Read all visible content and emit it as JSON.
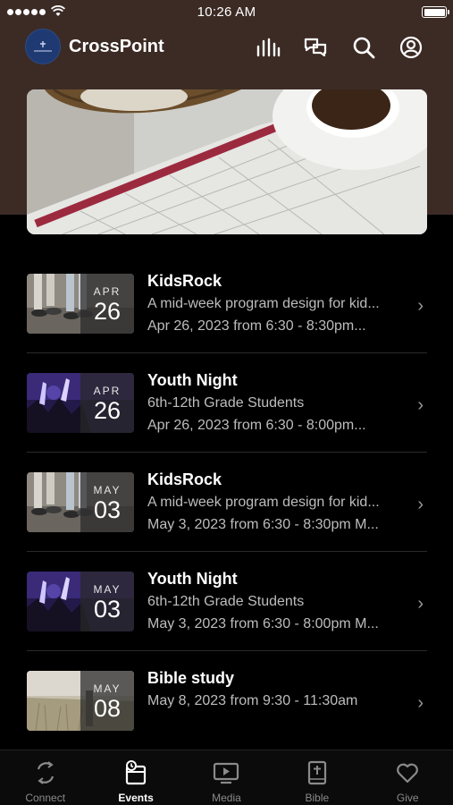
{
  "status_bar": {
    "time": "10:26 AM"
  },
  "header": {
    "title": "CrossPoint",
    "icons": [
      "equalizer-icon",
      "chat-icon",
      "search-icon",
      "profile-icon"
    ]
  },
  "hero": {
    "image": "calendar-and-coffee-photo"
  },
  "events": [
    {
      "title": "KidsRock",
      "month": "APR",
      "day": "26",
      "line1": "A mid-week program design for kid...",
      "line2": "Apr 26, 2023 from 6:30 - 8:30pm...",
      "thumbnail": "kids-feet-photo"
    },
    {
      "title": "Youth Night",
      "month": "APR",
      "day": "26",
      "line1": "6th-12th Grade Students",
      "line2": "Apr 26, 2023 from 6:30 - 8:00pm...",
      "thumbnail": "concert-hands-photo"
    },
    {
      "title": "KidsRock",
      "month": "MAY",
      "day": "03",
      "line1": "A mid-week program design for kid...",
      "line2": "May 3, 2023 from 6:30 - 8:30pm M...",
      "thumbnail": "kids-feet-photo"
    },
    {
      "title": "Youth Night",
      "month": "MAY",
      "day": "03",
      "line1": "6th-12th Grade Students",
      "line2": "May 3, 2023 from 6:30 - 8:00pm M...",
      "thumbnail": "concert-hands-photo"
    },
    {
      "title": "Bible study",
      "month": "MAY",
      "day": "08",
      "line1": "May 8, 2023 from 9:30 - 11:30am",
      "line2": "",
      "thumbnail": "field-photo"
    }
  ],
  "tabs": [
    {
      "label": "Connect",
      "icon": "connect-icon",
      "active": false
    },
    {
      "label": "Events",
      "icon": "events-icon",
      "active": true
    },
    {
      "label": "Media",
      "icon": "media-icon",
      "active": false
    },
    {
      "label": "Bible",
      "icon": "bible-icon",
      "active": false
    },
    {
      "label": "Give",
      "icon": "heart-icon",
      "active": false
    }
  ],
  "colors": {
    "header_bg": "#3c2b25",
    "background": "#000000",
    "secondary_text": "#bdbdbd",
    "logo_bg": "#1f3a72"
  }
}
